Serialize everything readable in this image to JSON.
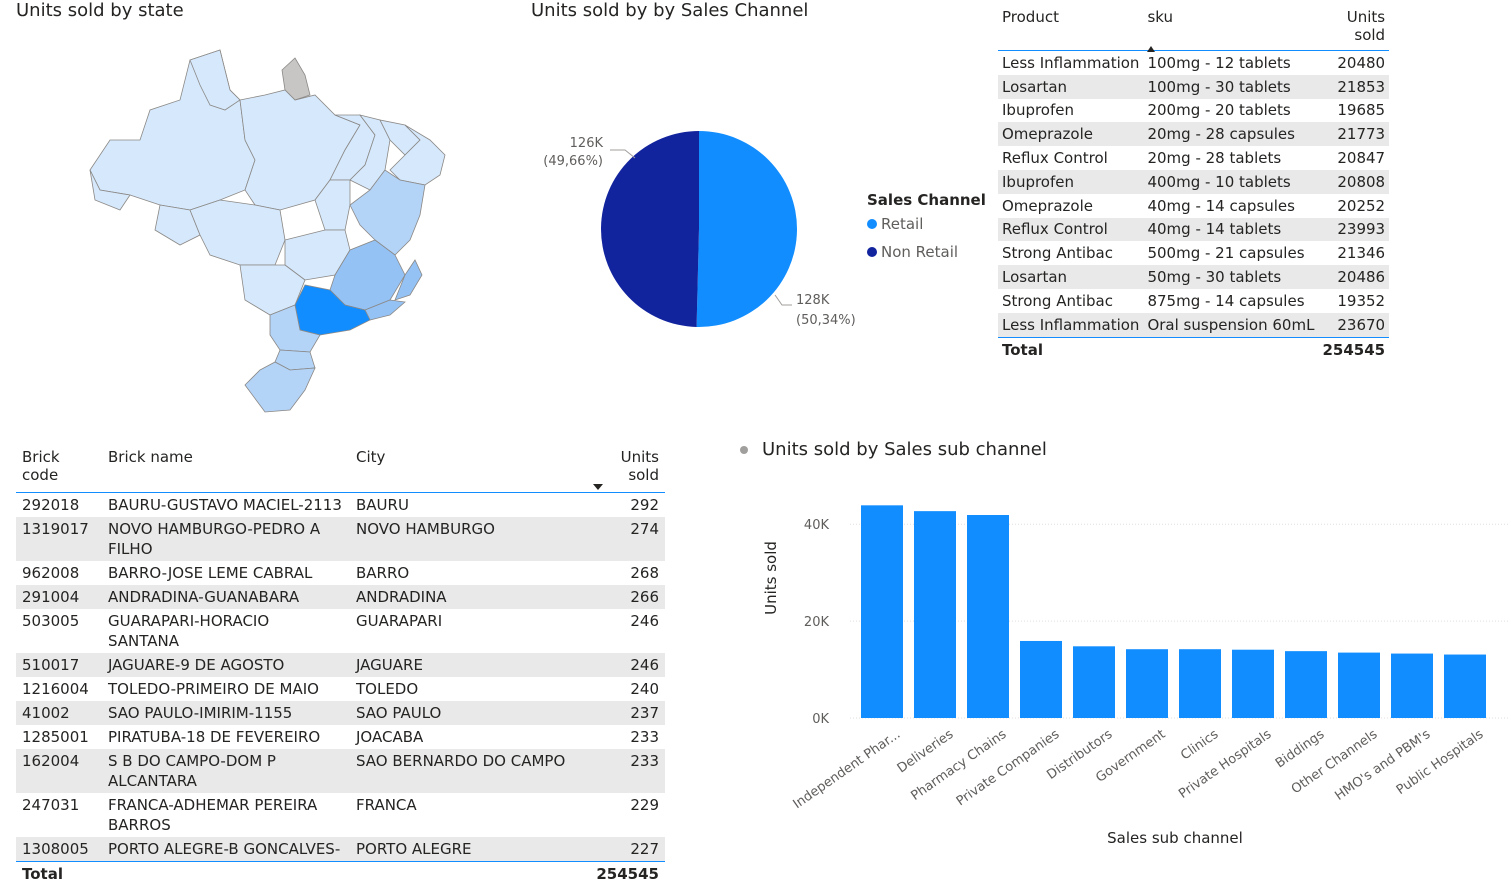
{
  "map": {
    "title": "Units sold by state"
  },
  "pie": {
    "title": "Units sold by by Sales Channel",
    "legend_title": "Sales Channel",
    "label_left_value": "126K",
    "label_left_pct": "(49,66%)",
    "label_right_value": "128K",
    "label_right_pct": "(50,34%)"
  },
  "product_table": {
    "headers": [
      "Product",
      "sku",
      "Units sold"
    ],
    "rows": [
      [
        "Less Inflammation",
        "100mg - 12 tablets",
        "20480"
      ],
      [
        "Losartan",
        "100mg - 30 tablets",
        "21853"
      ],
      [
        "Ibuprofen",
        "200mg - 20 tablets",
        "19685"
      ],
      [
        "Omeprazole",
        "20mg - 28 capsules",
        "21773"
      ],
      [
        "Reflux Control",
        "20mg - 28 tablets",
        "20847"
      ],
      [
        "Ibuprofen",
        "400mg - 10 tablets",
        "20808"
      ],
      [
        "Omeprazole",
        "40mg - 14 capsules",
        "20252"
      ],
      [
        "Reflux Control",
        "40mg - 14 tablets",
        "23993"
      ],
      [
        "Strong Antibac",
        "500mg - 21 capsules",
        "21346"
      ],
      [
        "Losartan",
        "50mg - 30 tablets",
        "20486"
      ],
      [
        "Strong Antibac",
        "875mg - 14 capsules",
        "19352"
      ],
      [
        "Less Inflammation",
        "Oral suspension 60mL",
        "23670"
      ]
    ],
    "total_label": "Total",
    "total_value": "254545"
  },
  "brick_table": {
    "headers": [
      "Brick code",
      "Brick name",
      "City",
      "Units sold"
    ],
    "rows": [
      [
        "292018",
        "BAURU-GUSTAVO MACIEL-2113",
        "BAURU",
        "292"
      ],
      [
        "1319017",
        "NOVO HAMBURGO-PEDRO A FILHO",
        "NOVO HAMBURGO",
        "274"
      ],
      [
        "962008",
        "BARRO-JOSE LEME CABRAL",
        "BARRO",
        "268"
      ],
      [
        "291004",
        "ANDRADINA-GUANABARA",
        "ANDRADINA",
        "266"
      ],
      [
        "503005",
        "GUARAPARI-HORACIO SANTANA",
        "GUARAPARI",
        "246"
      ],
      [
        "510017",
        "JAGUARE-9 DE AGOSTO",
        "JAGUARE",
        "246"
      ],
      [
        "1216004",
        "TOLEDO-PRIMEIRO DE MAIO",
        "TOLEDO",
        "240"
      ],
      [
        "41002",
        "SAO PAULO-IMIRIM-1155",
        "SAO PAULO",
        "237"
      ],
      [
        "1285001",
        "PIRATUBA-18 DE FEVEREIRO",
        "JOACABA",
        "233"
      ],
      [
        "162004",
        "S B DO CAMPO-DOM P ALCANTARA",
        "SAO BERNARDO DO CAMPO",
        "233"
      ],
      [
        "247031",
        "FRANCA-ADHEMAR PEREIRA BARROS",
        "FRANCA",
        "229"
      ],
      [
        "1308005",
        "PORTO ALEGRE-B GONCALVES-",
        "PORTO ALEGRE",
        "227"
      ]
    ],
    "total_label": "Total",
    "total_value": "254545"
  },
  "bar": {
    "title": "Units sold by Sales sub channel"
  },
  "colors": {
    "retail": "#118dff",
    "non_retail": "#12239e",
    "bar": "#118dff",
    "map_light": "#d6e8fb",
    "map_mid": "#b3d3f7",
    "map_dark": "#94c2f5",
    "map_sp": "#118dff",
    "map_grey": "#c8c6c4",
    "grid": "#e1dfdd",
    "axis_text": "#605e5c",
    "header_line": "#118dff"
  },
  "chart_data": [
    {
      "type": "pie",
      "title": "Units sold by by Sales Channel",
      "legend_title": "Sales Channel",
      "categories": [
        "Retail",
        "Non Retail"
      ],
      "values": [
        128000,
        126000
      ],
      "percentages": [
        50.34,
        49.66
      ],
      "legend_position": "right"
    },
    {
      "type": "bar",
      "title": "Units sold by Sales sub channel",
      "xlabel": "Sales sub channel",
      "ylabel": "Units sold",
      "categories": [
        "Independent Phar...",
        "Deliveries",
        "Pharmacy Chains",
        "Private Companies",
        "Distributors",
        "Government",
        "Clinics",
        "Private Hospitals",
        "Biddings",
        "Other Channels",
        "HMO's and PBM's",
        "Public Hospitals"
      ],
      "values": [
        43900,
        42700,
        41900,
        15900,
        14800,
        14200,
        14200,
        14100,
        13800,
        13500,
        13300,
        13100
      ],
      "yticks": [
        "0K",
        "20K",
        "40K"
      ],
      "ylim": [
        0,
        45000
      ],
      "grid": true
    }
  ]
}
